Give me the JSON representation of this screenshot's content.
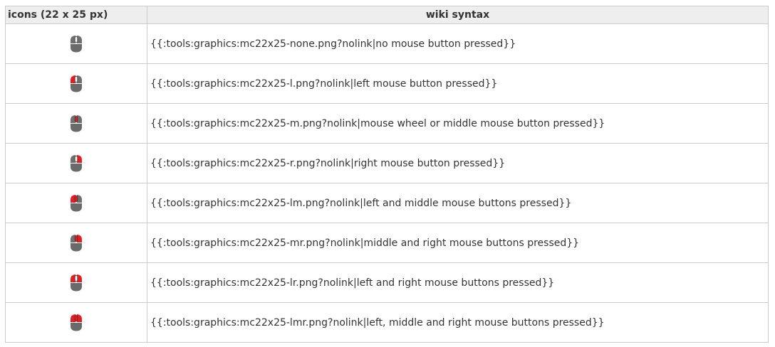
{
  "table": {
    "headers": {
      "icons": "icons (22 x 25 px)",
      "syntax": "wiki syntax"
    },
    "rows": [
      {
        "icon": "mouse-no-button-icon",
        "pressed": [],
        "syntax": "{{:tools:graphics:mc22x25-none.png?nolink|no mouse button pressed}}"
      },
      {
        "icon": "mouse-left-button-icon",
        "pressed": [
          "l"
        ],
        "syntax": "{{:tools:graphics:mc22x25-l.png?nolink|left mouse button pressed}}"
      },
      {
        "icon": "mouse-middle-button-icon",
        "pressed": [
          "m"
        ],
        "syntax": "{{:tools:graphics:mc22x25-m.png?nolink|mouse wheel or middle mouse button pressed}}"
      },
      {
        "icon": "mouse-right-button-icon",
        "pressed": [
          "r"
        ],
        "syntax": "{{:tools:graphics:mc22x25-r.png?nolink|right mouse button pressed}}"
      },
      {
        "icon": "mouse-left-middle-buttons-icon",
        "pressed": [
          "l",
          "m"
        ],
        "syntax": "{{:tools:graphics:mc22x25-lm.png?nolink|left and middle mouse buttons pressed}}"
      },
      {
        "icon": "mouse-middle-right-buttons-icon",
        "pressed": [
          "m",
          "r"
        ],
        "syntax": "{{:tools:graphics:mc22x25-mr.png?nolink|middle and right mouse buttons pressed}}"
      },
      {
        "icon": "mouse-left-right-buttons-icon",
        "pressed": [
          "l",
          "r"
        ],
        "syntax": "{{:tools:graphics:mc22x25-lr.png?nolink|left and right mouse buttons pressed}}"
      },
      {
        "icon": "mouse-all-buttons-icon",
        "pressed": [
          "l",
          "m",
          "r"
        ],
        "syntax": "{{:tools:graphics:mc22x25-lmr.png?nolink|left, middle and right mouse buttons pressed}}"
      }
    ]
  },
  "colors": {
    "pressed": "#e31e24",
    "unpressed": "#6f6f6f",
    "body": "#6a6a6a",
    "wheel_idle": "#ffffff",
    "header_bg": "#eeeeee",
    "border": "#cccccc"
  }
}
